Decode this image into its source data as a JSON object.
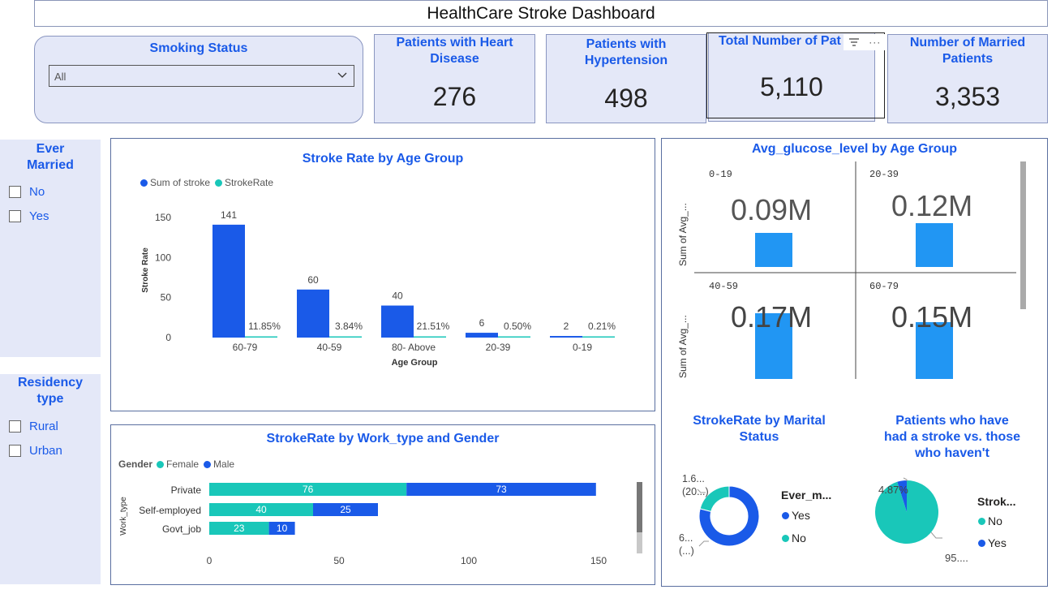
{
  "header": {
    "title": "HealthCare Stroke Dashboard"
  },
  "smoking_slicer": {
    "title": "Smoking Status",
    "selected": "All"
  },
  "kpis": [
    {
      "label": "Patients with Heart Disease",
      "value": "276"
    },
    {
      "label": "Patients with Hypertension",
      "value": "498"
    },
    {
      "label": "Total Number of Pat",
      "value": "5,110"
    },
    {
      "label": "Number of Married Patients",
      "value": "3,353"
    }
  ],
  "ever_married_slicer": {
    "title": "Ever Married",
    "options": [
      "No",
      "Yes"
    ]
  },
  "residency_slicer": {
    "title": "Residency type",
    "options": [
      "Rural",
      "Urban"
    ]
  },
  "colors": {
    "accent": "#1a5ae8",
    "bar_blue": "#1a5ae8",
    "teal": "#19c7b9",
    "glucose": "#2196f3",
    "card_bg": "#e4e8f8"
  },
  "chart_data": [
    {
      "type": "bar",
      "title": "Stroke Rate by Age Group",
      "xlabel": "Age Group",
      "ylabel": "Stroke Rate",
      "categories": [
        "60-79",
        "40-59",
        "80- Above",
        "20-39",
        "0-19"
      ],
      "series": [
        {
          "name": "Sum of stroke",
          "values": [
            141,
            60,
            40,
            6,
            2
          ],
          "labels": [
            "141",
            "60",
            "40",
            "6",
            "2"
          ]
        },
        {
          "name": "StrokeRate",
          "values": [
            11.85,
            3.84,
            21.51,
            0.5,
            0.21
          ],
          "labels": [
            "11.85%",
            "3.84%",
            "21.51%",
            "0.50%",
            "0.21%"
          ]
        }
      ],
      "yticks": [
        "0",
        "50",
        "100",
        "150"
      ],
      "ylim": [
        0,
        150
      ]
    },
    {
      "type": "bar",
      "orientation": "horizontal-stacked",
      "title": "StrokeRate by Work_type and Gender",
      "ylabel": "Work_type",
      "legend_title": "Gender",
      "categories": [
        "Private",
        "Self-employed",
        "Govt_job"
      ],
      "series": [
        {
          "name": "Female",
          "values": [
            76,
            40,
            23
          ]
        },
        {
          "name": "Male",
          "values": [
            73,
            25,
            10
          ]
        }
      ],
      "xticks": [
        "0",
        "50",
        "100",
        "150"
      ],
      "xlim": [
        0,
        150
      ]
    },
    {
      "type": "bar",
      "title": "Avg_glucose_level by Age Group",
      "ylabel": "Sum of Avg_...",
      "panels": [
        {
          "label": "0-19",
          "value_label": "0.09M",
          "value": 0.09
        },
        {
          "label": "20-39",
          "value_label": "0.12M",
          "value": 0.12
        },
        {
          "label": "40-59",
          "value_label": "0.17M",
          "value": 0.17
        },
        {
          "label": "60-79",
          "value_label": "0.15M",
          "value": 0.15
        }
      ]
    },
    {
      "type": "pie",
      "variant": "donut",
      "title": "StrokeRate by Marital Status",
      "legend_title": "Ever_m...",
      "slices": [
        {
          "name": "Yes",
          "value": 6,
          "label": "6... (...)"
        },
        {
          "name": "No",
          "value": 1.6,
          "label": "1.6... (20...)"
        }
      ]
    },
    {
      "type": "pie",
      "title": "Patients who have had a stroke vs. those who haven't",
      "legend_title": "Strok...",
      "slices": [
        {
          "name": "No",
          "value": 95.13,
          "label": "95...."
        },
        {
          "name": "Yes",
          "value": 4.87,
          "label": "4.87%"
        }
      ]
    }
  ]
}
